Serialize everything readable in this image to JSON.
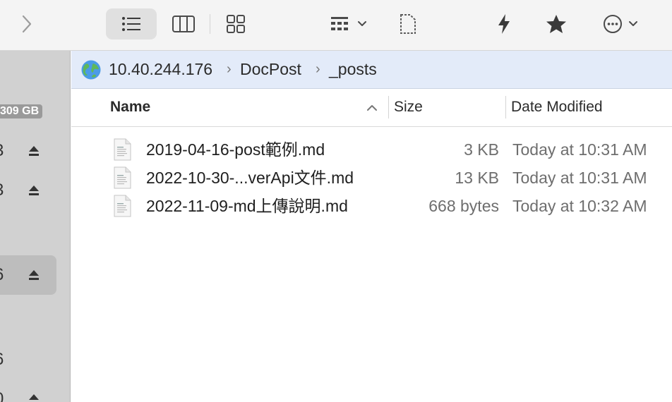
{
  "toolbar": {
    "items": [
      {
        "name": "forward-button",
        "icon": "chevron-right-icon"
      },
      {
        "name": "view-list-button",
        "icon": "list-icon",
        "selected": true
      },
      {
        "name": "view-columns-button",
        "icon": "columns-icon"
      },
      {
        "name": "view-icons-button",
        "icon": "grid-icon"
      },
      {
        "name": "group-by-button",
        "icon": "group-grid-icon"
      },
      {
        "name": "new-file-button",
        "icon": "document-icon"
      },
      {
        "name": "quick-action-button",
        "icon": "lightning-icon"
      },
      {
        "name": "favorite-button",
        "icon": "star-icon"
      },
      {
        "name": "more-button",
        "icon": "ellipsis-circle-icon"
      }
    ]
  },
  "sidebar": {
    "badge": "309 GB",
    "items": [
      {
        "text": "3",
        "eject": true
      },
      {
        "text": "3",
        "eject": true
      },
      {
        "text": "6",
        "eject": true,
        "selected": true
      },
      {
        "text": "6",
        "eject": false
      },
      {
        "text": "0",
        "eject": true
      }
    ]
  },
  "path": {
    "icon": "globe-icon",
    "crumbs": [
      "10.40.244.176",
      "DocPost",
      "_posts"
    ]
  },
  "columns": {
    "name": "Name",
    "size": "Size",
    "date": "Date Modified",
    "sort": "ascending"
  },
  "files": [
    {
      "name": "2019-04-16-post範例.md",
      "size": "3 KB",
      "date": "Today at 10:31 AM"
    },
    {
      "name": "2022-10-30-...verApi文件.md",
      "size": "13 KB",
      "date": "Today at 10:31 AM"
    },
    {
      "name": "2022-11-09-md上傳說明.md",
      "size": "668 bytes",
      "date": "Today at 10:32 AM"
    }
  ]
}
